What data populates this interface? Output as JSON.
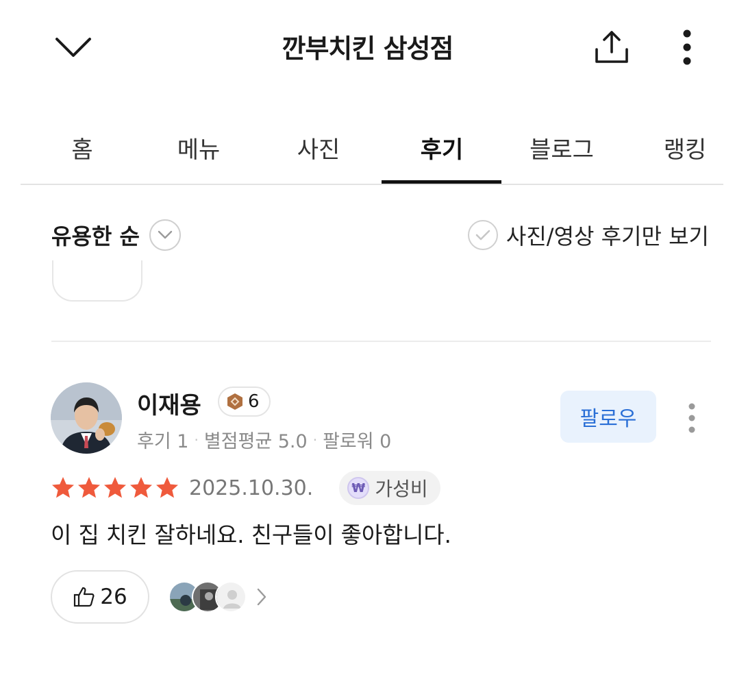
{
  "header": {
    "title": "깐부치킨 삼성점"
  },
  "tabs": [
    {
      "label": "홈"
    },
    {
      "label": "메뉴"
    },
    {
      "label": "사진"
    },
    {
      "label": "후기",
      "active": true
    },
    {
      "label": "블로그"
    },
    {
      "label": "랭킹"
    }
  ],
  "filter": {
    "sort_label": "유용한 순",
    "photo_only_label": "사진/영상 후기만 보기"
  },
  "review": {
    "reviewer_name": "이재용",
    "level": "6",
    "stats": {
      "reviews": "후기 1",
      "avg_rating": "별점평균 5.0",
      "followers": "팔로워 0"
    },
    "follow_label": "팔로우",
    "rating": 5,
    "date": "2025.10.30.",
    "keyword": "가성비",
    "text": "이 집 치킨 잘하네요. 친구들이 좋아합니다.",
    "likes": "26"
  },
  "colors": {
    "star": "#ef5a3c",
    "follow_bg": "#e9f2fd",
    "follow_text": "#2a6fd6",
    "badge_icon": "#b07040"
  },
  "icons": {
    "back": "chevron-down-icon",
    "share": "share-upload-icon",
    "more": "vertical-dots-icon",
    "like": "thumbs-up-icon",
    "keyword": "won-coin-icon"
  }
}
